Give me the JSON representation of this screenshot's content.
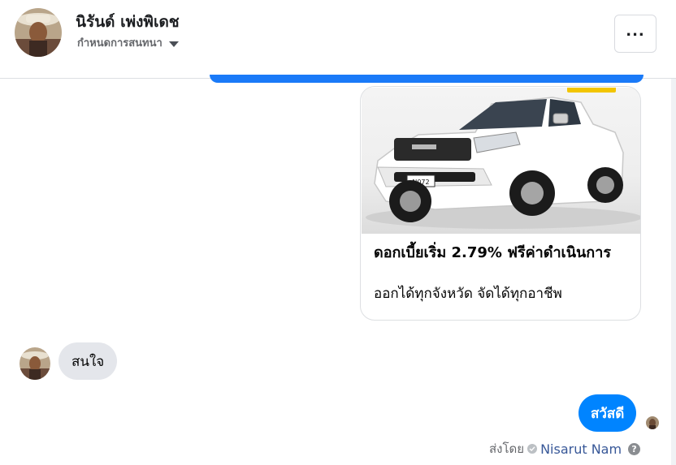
{
  "header": {
    "contact_name": "นิรันด์ เพ่งพิเดช",
    "settings_label": "กำหนดการสนทนา",
    "more_label": "..."
  },
  "conversation": {
    "card": {
      "image_alt": "white pickup truck photo",
      "title": "ดอกเบี้ยเริ่ม 2.79% ฟรีค่าดำเนินการ",
      "subtitle": "ออกได้ทุกจังหวัด จัดได้ทุกอาชีพ",
      "plate_text": "N072"
    },
    "incoming_message": "สนใจ",
    "outgoing_message": "สวัสดี",
    "sent_by_label": "ส่งโดย",
    "sender_name": "Nisarut Nam",
    "help_glyph": "?"
  },
  "colors": {
    "accent": "#0084ff",
    "incoming_bubble": "#e4e6eb",
    "link": "#385898",
    "muted_text": "#65676b"
  }
}
